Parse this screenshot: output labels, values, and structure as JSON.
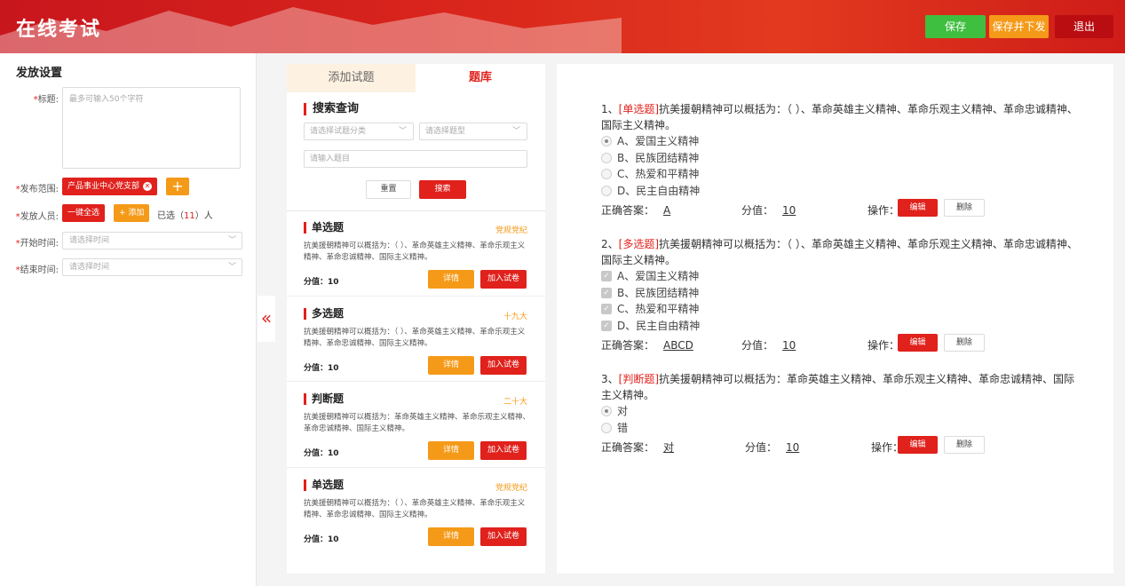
{
  "app": {
    "title": "在线考试"
  },
  "header": {
    "save_label": "保存",
    "save_send_label": "保存并下发",
    "exit_label": "退出"
  },
  "settings": {
    "section_title": "发放设置",
    "title_label": "标题:",
    "title_placeholder": "最多可输入50个字符",
    "scope_label": "发布范围:",
    "scope_tag": "产品事业中心党支部",
    "people_label": "发放人员:",
    "select_all_label": "一键全选",
    "add_label": "+ 添加",
    "selected_prefix": "已选（",
    "selected_count": "11",
    "selected_suffix": "）人",
    "start_label": "开始时间:",
    "start_placeholder": "请选择时间",
    "end_label": "结束时间:",
    "end_placeholder": "请选择时间",
    "required_mark": "*"
  },
  "bank": {
    "tabs": [
      {
        "label": "添加试题"
      },
      {
        "label": "题库"
      }
    ],
    "search_title": "搜索查询",
    "category_placeholder": "请选择试题分类",
    "type_placeholder": "请选择题型",
    "keyword_placeholder": "请输入题目",
    "reset_label": "重置",
    "search_label": "搜索",
    "detail_label": "详情",
    "add_label": "加入试卷",
    "cards": [
      {
        "type": "单选题",
        "tag": "党规党纪",
        "desc": "抗美援朝精神可以概括为：（  ）、革命英雄主义精神、革命乐观主义精神、革命忠诚精神、国际主义精神。",
        "score": "分值：10"
      },
      {
        "type": "多选题",
        "tag": "十九大",
        "desc": "抗美援朝精神可以概括为：（  ）、革命英雄主义精神、革命乐观主义精神、革命忠诚精神、国际主义精神。",
        "score": "分值：10"
      },
      {
        "type": "判断题",
        "tag": "二十大",
        "desc": "抗美援朝精神可以概括为：革命英雄主义精神、革命乐观主义精神、革命忠诚精神、国际主义精神。",
        "score": "分值：10"
      },
      {
        "type": "单选题",
        "tag": "党规党纪",
        "desc": "抗美援朝精神可以概括为：（  ）、革命英雄主义精神、革命乐观主义精神、革命忠诚精神、国际主义精神。",
        "score": "分值：10"
      }
    ]
  },
  "paper": {
    "answer_label": "正确答案：",
    "score_label": "分值：",
    "op_label": "操作：",
    "edit_label": "编辑",
    "delete_label": "删除",
    "questions": [
      {
        "num": "1、",
        "type": "[单选题]",
        "text": "抗美援朝精神可以概括为：（  ）、革命英雄主义精神、革命乐观主义精神、革命忠诚精神、国际主义精神。",
        "options": [
          "A、爱国主义精神",
          "B、民族团结精神",
          "C、热爱和平精神",
          "D、民主自由精神"
        ],
        "answer": "A",
        "score": "10"
      },
      {
        "num": "2、",
        "type": "[多选题]",
        "text": "抗美援朝精神可以概括为：（  ）、革命英雄主义精神、革命乐观主义精神、革命忠诚精神、国际主义精神。",
        "options": [
          "A、爱国主义精神",
          "B、民族团结精神",
          "C、热爱和平精神",
          "D、民主自由精神"
        ],
        "answer": "ABCD",
        "score": "10"
      },
      {
        "num": "3、",
        "type": "[判断题]",
        "text": "抗美援朝精神可以概括为：革命英雄主义精神、革命乐观主义精神、革命忠诚精神、国际主义精神。",
        "options": [
          "对",
          "错"
        ],
        "answer": "对",
        "score": "10"
      }
    ]
  },
  "colors": {
    "brand_red": "#e0211c",
    "orange": "#f59a18",
    "green": "#3fbf3f",
    "dark_red": "#b90d12"
  },
  "icons": {
    "collapse": "double-chevron-left-icon",
    "close": "close-circle-icon",
    "plus": "plus-icon",
    "dropdown": "chevron-down-icon",
    "checkbox": "checkbox-checked-icon",
    "radio": "radio-icon"
  }
}
